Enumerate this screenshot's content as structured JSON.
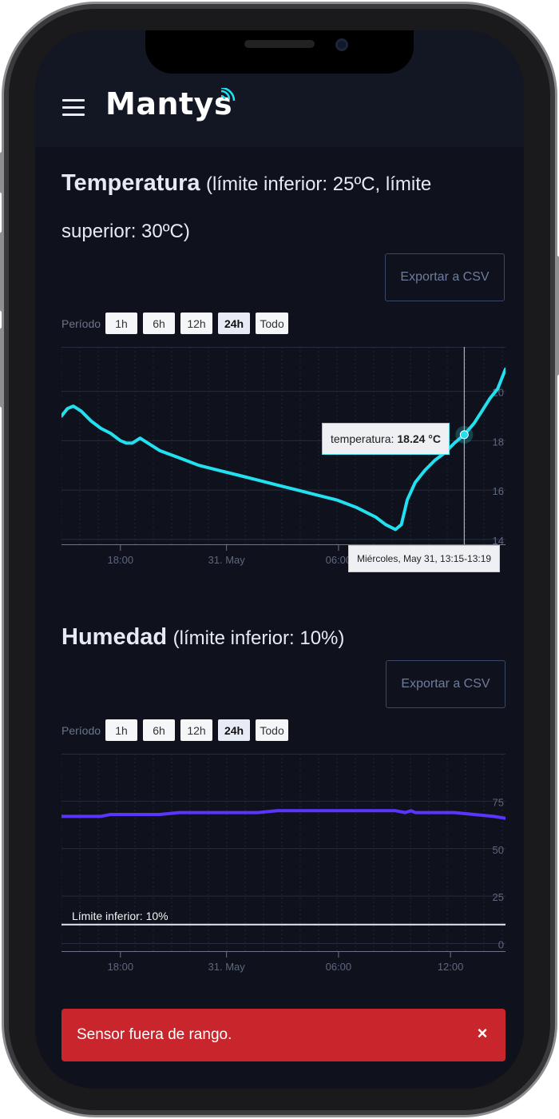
{
  "app": {
    "name": "Mantys"
  },
  "temperature": {
    "title": "Temperatura (límite inferior: 25ºC, límite superior: 30ºC)",
    "title_line1": "Temperatura",
    "title_line1_rest": "(límite inferior: 25ºC, límite",
    "title_line2": "superior: 30ºC)",
    "export_label": "Exportar a CSV",
    "period_label": "Período",
    "periods": [
      "1h",
      "6h",
      "12h",
      "24h",
      "Todo"
    ],
    "active_period": "24h",
    "tooltip_series": "temperatura:",
    "tooltip_value": "18.24 °C",
    "x_tooltip": "Miércoles, May 31, 13:15-13:19"
  },
  "humidity": {
    "title": "Humedad (límite inferior: 10%)",
    "title_main": "Humedad",
    "title_rest": "(límite inferior: 10%)",
    "export_label": "Exportar a CSV",
    "period_label": "Período",
    "periods": [
      "1h",
      "6h",
      "12h",
      "24h",
      "Todo"
    ],
    "active_period": "24h",
    "plotline_label": "Límite inferior: 10%"
  },
  "toast": {
    "message": "Sensor fuera de rango.",
    "close_symbol": "×"
  },
  "colors": {
    "background": "#0f121c",
    "temperature_line": "#22e0f0",
    "humidity_line": "#5b34ff",
    "toast_bg": "#c9252c"
  },
  "chart_data": [
    {
      "type": "line",
      "title": "",
      "xlabel": "",
      "ylabel": "",
      "x_ticks": [
        "18:00",
        "31. May",
        "06:00"
      ],
      "y_ticks": [
        14,
        16,
        18,
        20
      ],
      "ylim": [
        13.8,
        21.8
      ],
      "series": [
        {
          "name": "temperatura",
          "color": "#22e0f0",
          "x": [
            0,
            0.3,
            0.6,
            1,
            1.5,
            2,
            2.5,
            3,
            3.3,
            3.6,
            4,
            5,
            6,
            7,
            8,
            9,
            10,
            11,
            12,
            13,
            14,
            15,
            16,
            16.5,
            17,
            17.3,
            17.6,
            18,
            18.5,
            19,
            19.5,
            20,
            20.5,
            21,
            21.4,
            21.8,
            22.2,
            22.6
          ],
          "y": [
            19.0,
            19.3,
            19.4,
            19.2,
            18.8,
            18.5,
            18.3,
            18.0,
            17.9,
            17.9,
            18.1,
            17.6,
            17.3,
            17.0,
            16.8,
            16.6,
            16.4,
            16.2,
            16.0,
            15.8,
            15.6,
            15.3,
            14.9,
            14.6,
            14.4,
            14.6,
            15.6,
            16.3,
            16.8,
            17.2,
            17.5,
            17.9,
            18.24,
            18.7,
            19.2,
            19.7,
            20.1,
            20.9
          ]
        }
      ],
      "grid": true
    },
    {
      "type": "line",
      "title": "",
      "xlabel": "",
      "ylabel": "",
      "x_ticks": [
        "18:00",
        "31. May",
        "06:00",
        "12:00"
      ],
      "y_ticks": [
        0,
        25,
        50,
        75
      ],
      "ylim": [
        -4,
        100
      ],
      "plot_line": {
        "value": 10,
        "label": "Límite inferior: 10%"
      },
      "series": [
        {
          "name": "humedad",
          "color": "#5b34ff",
          "x": [
            0,
            2,
            2.5,
            5,
            6,
            7,
            10,
            11,
            17,
            17.5,
            17.8,
            18,
            19,
            20,
            21,
            22,
            22.6
          ],
          "y": [
            67,
            67,
            68,
            68,
            69,
            69,
            69,
            70,
            70,
            69,
            70,
            69,
            69,
            69,
            68,
            67,
            66
          ]
        }
      ],
      "grid": true
    }
  ]
}
